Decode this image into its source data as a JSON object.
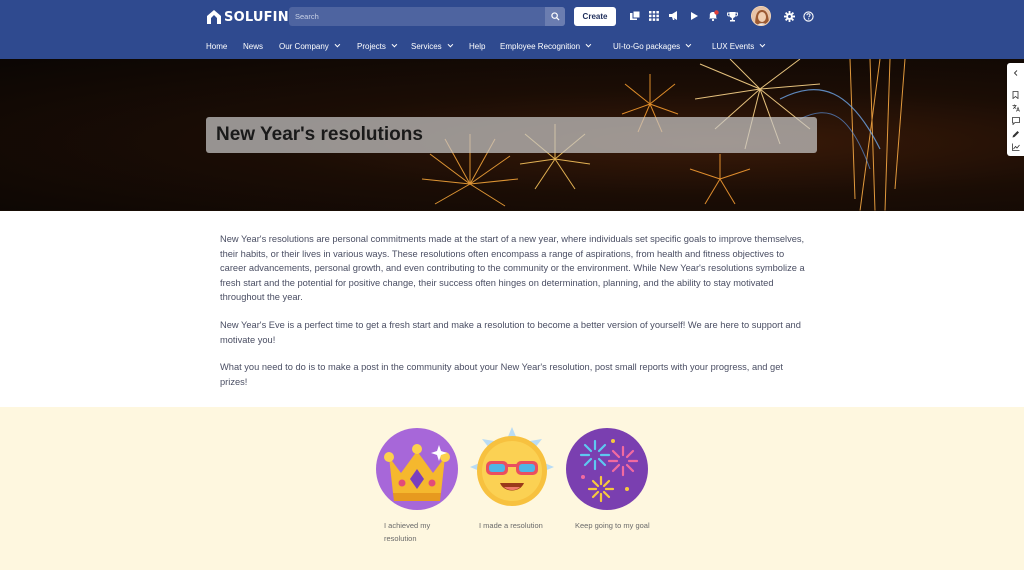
{
  "header": {
    "logo_text": "SOLUFIND",
    "search_placeholder": "Search",
    "create_label": "Create",
    "icons": [
      "grid-squares-icon",
      "apps-icon",
      "megaphone-icon",
      "play-icon",
      "bell-icon",
      "trophy-icon",
      "gear-icon",
      "help-icon"
    ],
    "accent": "#2f4a8f"
  },
  "nav": {
    "items": [
      {
        "label": "Home",
        "dropdown": false
      },
      {
        "label": "News",
        "dropdown": false
      },
      {
        "label": "Our Company",
        "dropdown": true
      },
      {
        "label": "Projects",
        "dropdown": true
      },
      {
        "label": "Services",
        "dropdown": true
      },
      {
        "label": "Help",
        "dropdown": false
      },
      {
        "label": "Employee Recognition",
        "dropdown": true
      },
      {
        "label": "UI-to-Go packages",
        "dropdown": true
      },
      {
        "label": "LUX Events",
        "dropdown": true
      }
    ]
  },
  "hero": {
    "title": "New Year's resolutions"
  },
  "side_toolbar": {
    "icons": [
      "collapse-icon",
      "bookmark-icon",
      "translate-icon",
      "comment-icon",
      "edit-icon",
      "analytics-icon"
    ]
  },
  "content": {
    "p1": "New Year's resolutions are personal commitments made at the start of a new year, where individuals set specific goals to improve themselves, their habits, or their lives in various ways. These resolutions often encompass a range of aspirations, from health and fitness objectives to career advancements, personal growth, and even contributing to the community or the environment. While New Year's resolutions symbolize a fresh start and the potential for positive change, their success often hinges on determination, planning, and the ability to stay motivated throughout the year.",
    "p2": "New Year's Eve is a perfect time to get a fresh start and make a resolution to become a better version of yourself! We are here to support and motivate you!",
    "p3": "What you need to do is to make a post in the community about your New Year's resolution, post small reports with your progress, and get prizes!"
  },
  "rewards": {
    "background": "#fef7df",
    "badges": [
      {
        "label": "I achieved my resolution",
        "icon": "crown-badge-icon"
      },
      {
        "label": "I made a resolution",
        "icon": "sunglasses-face-badge-icon"
      },
      {
        "label": "Keep going to my goal",
        "icon": "fireworks-badge-icon"
      }
    ]
  }
}
